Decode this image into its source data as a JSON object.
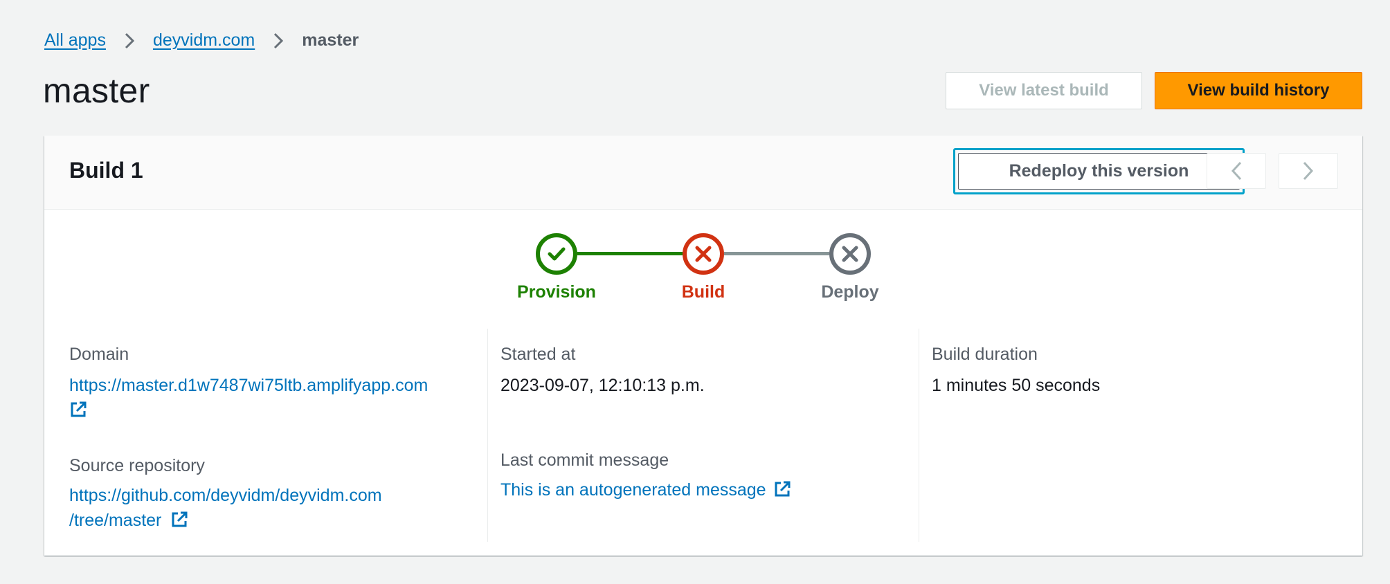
{
  "breadcrumb": {
    "items": [
      "All apps",
      "deyvidm.com"
    ],
    "current": "master"
  },
  "page": {
    "title": "master"
  },
  "header_buttons": {
    "view_latest_build": "View latest build",
    "view_build_history": "View build history"
  },
  "build": {
    "title": "Build 1",
    "redeploy_label": "Redeploy this version",
    "steps": [
      {
        "label": "Provision",
        "status": "success",
        "color": "#1d8102"
      },
      {
        "label": "Build",
        "status": "failed",
        "color": "#d13212"
      },
      {
        "label": "Deploy",
        "status": "cancelled",
        "color": "#687078"
      }
    ],
    "details": {
      "domain": {
        "label": "Domain",
        "value": "https://master.d1w7487wi75ltb.amplifyapp.com"
      },
      "source_repository": {
        "label": "Source repository",
        "value_line1": "https://github.com/deyvidm/deyvidm.com",
        "value_line2": "/tree/master"
      },
      "started_at": {
        "label": "Started at",
        "value": "2023-09-07, 12:10:13 p.m."
      },
      "last_commit_message": {
        "label": "Last commit message",
        "value": "This is an autogenerated message"
      },
      "build_duration": {
        "label": "Build duration",
        "value": "1 minutes 50 seconds"
      }
    }
  },
  "colors": {
    "link": "#0073bb",
    "primary_button": "#ff9900",
    "focus_ring": "#00a1c9",
    "success": "#1d8102",
    "error": "#d13212",
    "neutral": "#687078"
  }
}
